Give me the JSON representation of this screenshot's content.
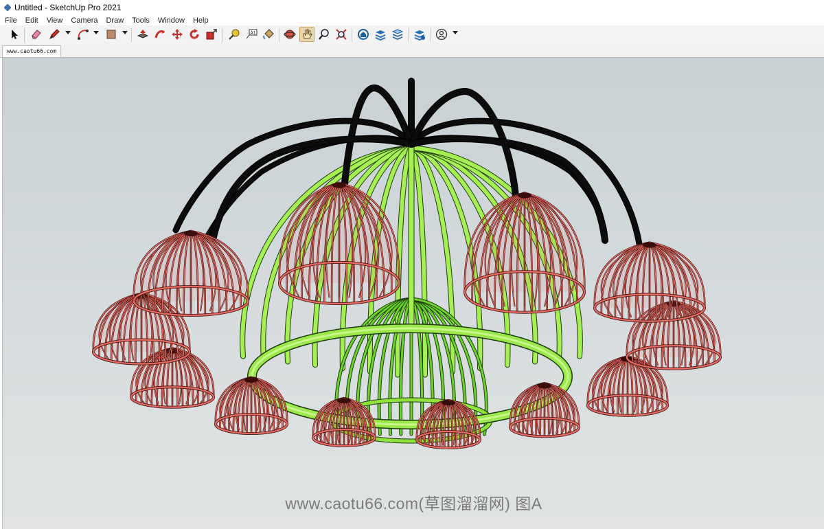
{
  "window": {
    "title": "Untitled - SketchUp Pro 2021"
  },
  "menu": [
    "File",
    "Edit",
    "View",
    "Camera",
    "Draw",
    "Tools",
    "Window",
    "Help"
  ],
  "toolbar": {
    "tools": [
      "select-icon",
      "eraser-icon",
      "pencil-icon",
      "arc-icon",
      "rectangle-icon",
      "push-pull-icon",
      "follow-me-icon",
      "move-icon",
      "rotate-icon",
      "scale-icon",
      "tape-measure-icon",
      "text-icon",
      "paint-bucket-icon",
      "orbit-icon",
      "pan-icon",
      "zoom-icon",
      "zoom-extents-icon",
      "warehouse-icon",
      "layers-icon",
      "styles-icon",
      "scenes-icon",
      "account-icon"
    ],
    "active_tool": "pan-icon"
  },
  "tabs": [
    {
      "label": "www.caotu66.com"
    }
  ],
  "viewport": {
    "watermark": "www.caotu66.com(草图溜溜网) 图A",
    "colors": {
      "frame": "#0c0c0c",
      "cage": "#8fe23a",
      "shade": "#e56b63"
    }
  }
}
